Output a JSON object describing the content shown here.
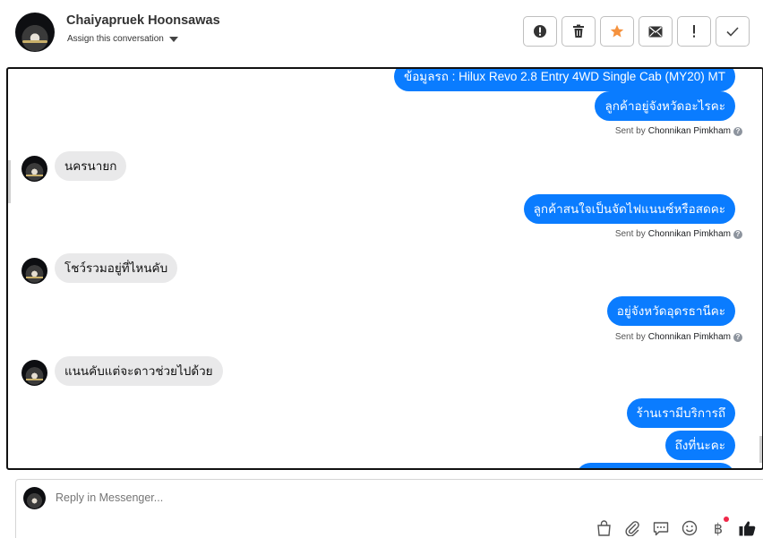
{
  "header": {
    "name": "Chaiyapruek Hoonsawas",
    "assign_label": "Assign this conversation",
    "actions": [
      {
        "icon": "alert-circle-icon"
      },
      {
        "icon": "trash-icon"
      },
      {
        "icon": "star-icon",
        "color": "#f5923e"
      },
      {
        "icon": "envelope-icon"
      },
      {
        "icon": "exclamation-icon"
      },
      {
        "icon": "check-icon"
      }
    ]
  },
  "messages": [
    {
      "dir": "out",
      "text": "ข้อมูลรถ : Hilux Revo 2.8 Entry 4WD Single Cab (MY20) MT"
    },
    {
      "dir": "out",
      "text": "ลูกค้าอยู่จังหวัดอะไรคะ"
    },
    {
      "dir": "sent_by",
      "prefix": "Sent by",
      "agent": "Chonnikan Pimkham"
    },
    {
      "dir": "in",
      "text": "นครนายก"
    },
    {
      "dir": "out",
      "text": "ลูกค้าสนใจเป็นจัดไฟแนนซ์หรือสดคะ"
    },
    {
      "dir": "sent_by",
      "prefix": "Sent by",
      "agent": "Chonnikan Pimkham"
    },
    {
      "dir": "in",
      "text": "โชว์รวมอยู่ที่ไหนคับ"
    },
    {
      "dir": "out",
      "text": "อยู่จังหวัดอุดรธานีคะ"
    },
    {
      "dir": "sent_by",
      "prefix": "Sent by",
      "agent": "Chonnikan Pimkham"
    },
    {
      "dir": "in",
      "text": "แนนคับแต่จะดาวช่วยไปด้วย"
    },
    {
      "dir": "out",
      "text": "ร้านเรามีบริการถึ"
    },
    {
      "dir": "out",
      "text": "ถึงที่นะคะ"
    }
  ],
  "composer": {
    "placeholder": "Reply in Messenger...",
    "tools": [
      "shopping-bag-icon",
      "paperclip-icon",
      "saved-reply-icon",
      "emoji-icon",
      "baht-icon",
      "like-icon"
    ],
    "baht_symbol": "฿",
    "accent": "#0a7cff"
  }
}
